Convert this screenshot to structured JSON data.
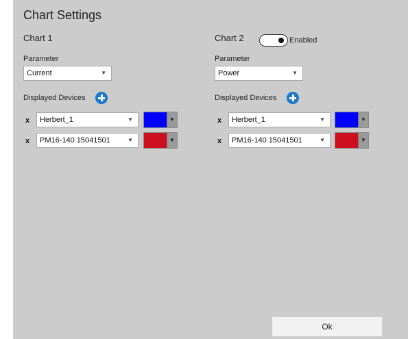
{
  "dialog": {
    "title": "Chart Settings",
    "ok_label": "Ok"
  },
  "chart1": {
    "title": "Chart 1",
    "parameter_label": "Parameter",
    "parameter_value": "Current",
    "devices_label": "Displayed Devices",
    "devices": [
      {
        "name": "Herbert_1",
        "color": "#0000ff"
      },
      {
        "name": "PM16-140 15041501",
        "color": "#cc0e1e"
      }
    ]
  },
  "chart2": {
    "title": "Chart 2",
    "enabled_label": "Enabled",
    "enabled": true,
    "parameter_label": "Parameter",
    "parameter_value": "Power",
    "devices_label": "Displayed Devices",
    "devices": [
      {
        "name": "Herbert_1",
        "color": "#0000ff"
      },
      {
        "name": "PM16-140 15041501",
        "color": "#cc0e1e"
      }
    ]
  },
  "icons": {
    "dropdown_caret": "▼",
    "remove": "x"
  }
}
